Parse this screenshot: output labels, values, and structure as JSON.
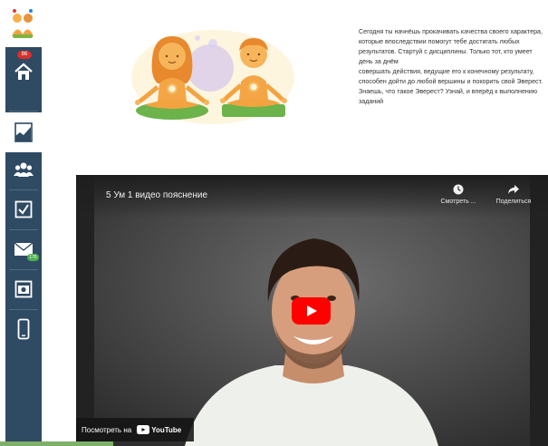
{
  "sidebar": {
    "mail_badge": "86",
    "messages_badge": "176",
    "items": [
      {
        "name": "home",
        "icon": "home-icon"
      },
      {
        "name": "progress",
        "icon": "chart-icon",
        "active": true
      },
      {
        "name": "community",
        "icon": "users-icon"
      },
      {
        "name": "tasks",
        "icon": "checkbox-icon"
      },
      {
        "name": "messages",
        "icon": "envelope-icon"
      },
      {
        "name": "photos",
        "icon": "camera-icon"
      },
      {
        "name": "mobile",
        "icon": "phone-icon"
      }
    ]
  },
  "description": {
    "line1": "Сегодня ты начнёшь прокачивать качества своего характера, которые впоследствии помогут тебе достигать любых результатов. Стартуй с дисциплины. Только тот, кто умеет день за днём",
    "line2": "совершать действия, ведущие его к конечному результату, способен дойти до любой вершины и покорить свой Эверест. Знаешь, что такое Эверест? Узнай, и вперёд к выполнению заданий"
  },
  "video": {
    "title": "5 Ум 1 видео пояснение",
    "watch_later_label": "Смотреть ...",
    "share_label": "Поделиться",
    "watch_on_label": "Посмотреть на",
    "youtube_label": "YouTube"
  },
  "colors": {
    "sidebar": "#2f4a63",
    "youtube_red": "#ff0000",
    "accent_orange": "#f5a623"
  }
}
